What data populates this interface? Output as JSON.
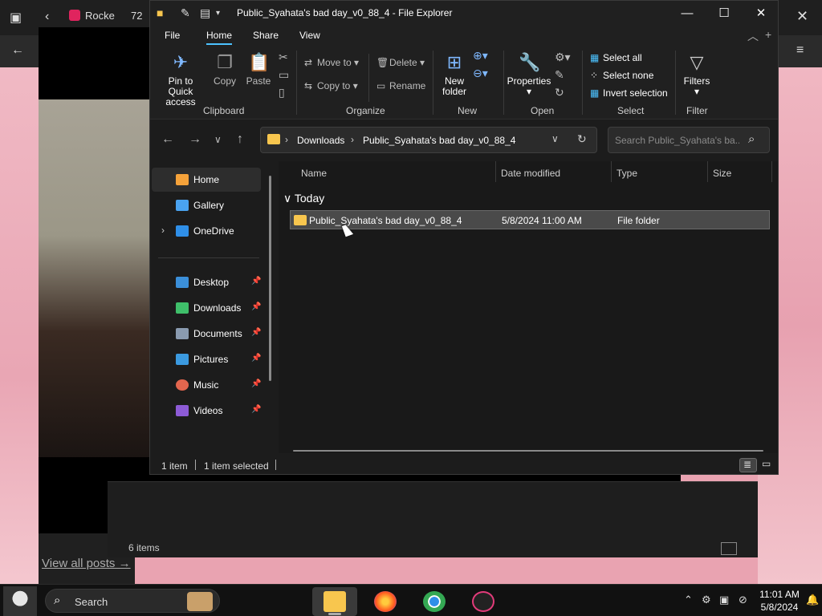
{
  "background": {
    "browser_tab_label": "Rocke",
    "second_tab_label": "72",
    "status_items": "6 items",
    "view_all_posts": "View all posts →"
  },
  "window": {
    "title": "Public_Syahata's bad day_v0_88_4 - File Explorer"
  },
  "menu": {
    "file": "File",
    "home": "Home",
    "share": "Share",
    "view": "View"
  },
  "ribbon": {
    "clipboard": {
      "label": "Clipboard",
      "pin": "Pin to Quick access",
      "copy": "Copy",
      "paste": "Paste"
    },
    "organize": {
      "label": "Organize",
      "move_to": "Move to",
      "copy_to": "Copy to",
      "delete": "Delete",
      "rename": "Rename"
    },
    "new": {
      "label": "New",
      "new_folder": "New folder"
    },
    "open": {
      "label": "Open",
      "properties": "Properties"
    },
    "select": {
      "label": "Select",
      "select_all": "Select all",
      "select_none": "Select none",
      "invert": "Invert selection"
    },
    "filter": {
      "label": "Filter",
      "filters": "Filters"
    }
  },
  "address": {
    "segments": [
      "Downloads",
      "Public_Syahata's bad day_v0_88_4"
    ]
  },
  "search": {
    "placeholder": "Search Public_Syahata's ba..."
  },
  "navigation": {
    "items": [
      {
        "label": "Home",
        "icon": "home-icon",
        "color": "#f5a23a"
      },
      {
        "label": "Gallery",
        "icon": "gallery-icon",
        "color": "#4aa3f0"
      },
      {
        "label": "OneDrive",
        "icon": "cloud-icon",
        "color": "#2f8fe8"
      },
      {
        "label": "Desktop",
        "icon": "desktop-icon",
        "color": "#3b8fd9"
      },
      {
        "label": "Downloads",
        "icon": "download-icon",
        "color": "#3fbf6a"
      },
      {
        "label": "Documents",
        "icon": "document-icon",
        "color": "#8a9bb0"
      },
      {
        "label": "Pictures",
        "icon": "pictures-icon",
        "color": "#3b9ae0"
      },
      {
        "label": "Music",
        "icon": "music-icon",
        "color": "#e3664e"
      },
      {
        "label": "Videos",
        "icon": "video-icon",
        "color": "#8d5bd6"
      }
    ]
  },
  "columns": {
    "name": "Name",
    "date": "Date modified",
    "type": "Type",
    "size": "Size"
  },
  "groups": {
    "today": "Today"
  },
  "files": [
    {
      "name": "Public_Syahata's bad day_v0_88_4",
      "date": "5/8/2024 11:00 AM",
      "type": "File folder",
      "size": ""
    }
  ],
  "status": {
    "count": "1 item",
    "selected": "1 item selected"
  },
  "taskbar": {
    "search_label": "Search",
    "time": "11:01 AM",
    "date": "5/8/2024"
  }
}
